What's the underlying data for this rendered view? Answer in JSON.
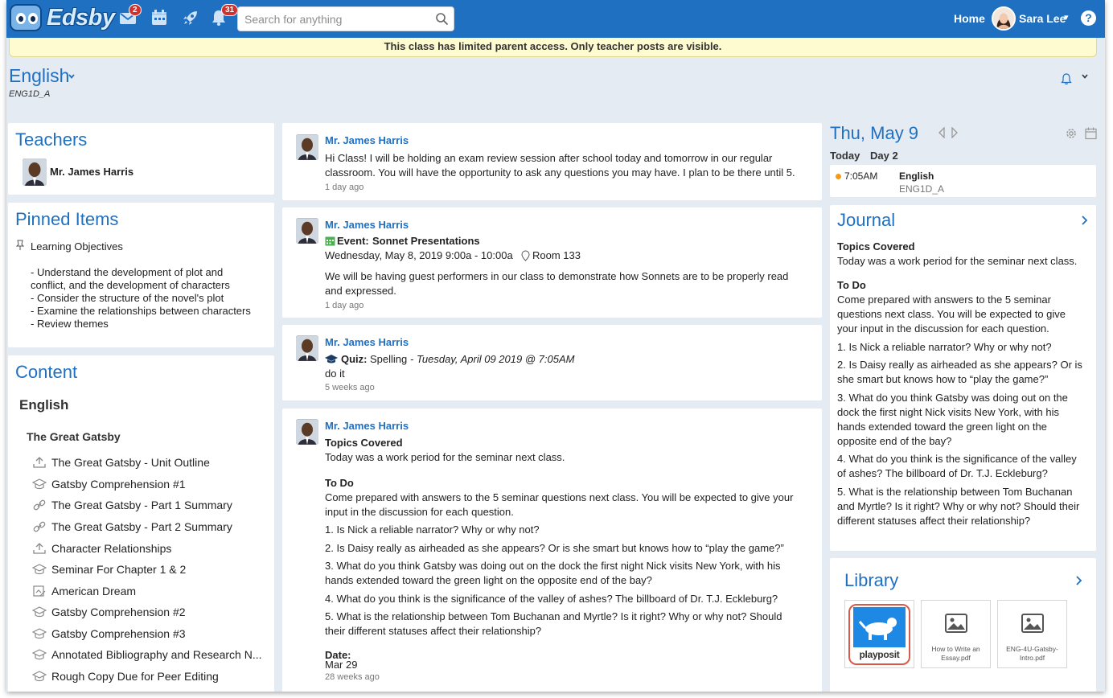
{
  "topbar": {
    "logo_text": "Edsby",
    "messages_badge": "2",
    "notifications_badge": "31",
    "search_placeholder": "Search for anything",
    "home_label": "Home",
    "user_name": "Sara Lee",
    "help_label": "?"
  },
  "banner": "This class has limited parent access. Only teacher posts are visible.",
  "class": {
    "title": "English",
    "code": "ENG1D_A"
  },
  "teachers": {
    "title": "Teachers",
    "name": "Mr. James Harris"
  },
  "pinned": {
    "title": "Pinned Items",
    "item_title": "Learning Objectives",
    "lines": [
      "- Understand the development of plot and",
      "conflict, and the development of characters",
      "- Consider the structure of the novel's plot",
      "- Examine the relationships between characters",
      "- Review themes"
    ]
  },
  "content": {
    "title": "Content",
    "course": "English",
    "unit": "The Great Gatsby",
    "items": [
      {
        "label": "The Great Gatsby - Unit Outline",
        "icon": "upload-icon"
      },
      {
        "label": "Gatsby Comprehension #1",
        "icon": "graduation-cap-icon"
      },
      {
        "label": "The Great Gatsby - Part 1 Summary",
        "icon": "link-icon"
      },
      {
        "label": "The Great Gatsby - Part 2 Summary",
        "icon": "link-icon"
      },
      {
        "label": "Character Relationships",
        "icon": "upload-icon"
      },
      {
        "label": "Seminar For Chapter 1 & 2",
        "icon": "graduation-cap-icon"
      },
      {
        "label": "American Dream",
        "icon": "assignment-icon"
      },
      {
        "label": "Gatsby Comprehension #2",
        "icon": "graduation-cap-icon"
      },
      {
        "label": "Gatsby Comprehension #3",
        "icon": "graduation-cap-icon"
      },
      {
        "label": "Annotated Bibliography and Research N...",
        "icon": "graduation-cap-icon"
      },
      {
        "label": "Rough Copy Due for Peer Editing",
        "icon": "graduation-cap-icon"
      }
    ]
  },
  "feed": {
    "posts": [
      {
        "author": "Mr. James Harris",
        "lines": [
          "Hi Class! I will be holding an exam review session after school today and tomorrow in our regular",
          "classroom. You will have the opportunity to ask any questions you may have. I plan to be there until 5."
        ],
        "ago": "1 day ago"
      },
      {
        "author": "Mr. James Harris",
        "event_label": "Event:",
        "event_title": "Sonnet Presentations",
        "event_time": "Wednesday, May 8, 2019 9:00a - 10:00a",
        "event_room": "Room 133",
        "lines": [
          "We will be having guest performers in our class to demonstrate how Sonnets are to be properly read",
          "and expressed."
        ],
        "ago": "1 day ago"
      },
      {
        "author": "Mr. James Harris",
        "quiz_label": "Quiz:",
        "quiz_title": "Spelling",
        "quiz_due": "- Tuesday, April 09 2019 @ 7:05AM",
        "body": "do it",
        "ago": "5 weeks ago"
      },
      {
        "author": "Mr. James Harris",
        "h1": "Topics Covered",
        "p1": "Today was a work period for the seminar next class.",
        "h2": "To Do",
        "p2a": "Come prepared with answers to the 5 seminar questions next class. You will be expected to give your",
        "p2b": "input in the discussion for each question.",
        "q1": "1. Is Nick a reliable narrator? Why or why not?",
        "q2": "2. Is Daisy really as airheaded as she appears? Or is she smart but knows how to “play the game?”",
        "q3a": "3. What do you think Gatsby was doing out on the dock the first night Nick visits New York, with his",
        "q3b": "hands extended toward the green light on the opposite end of the bay?",
        "q4": "4. What do you think is the significance of the valley of ashes? The billboard of Dr. T.J. Eckleburg?",
        "q5a": "5. What is the relationship between Tom Buchanan and Myrtle? Is it right? Why or why not? Should",
        "q5b": "their different statuses affect their relationship?",
        "date_label": "Date:",
        "date_value": "Mar 29",
        "ago": "28 weeks ago"
      }
    ]
  },
  "calendar": {
    "date": "Thu, May 9",
    "today": "Today",
    "day": "Day 2",
    "event_time": "7:05AM",
    "event_title": "English",
    "event_code": "ENG1D_A",
    "dot_color": "#f39c12"
  },
  "journal": {
    "title": "Journal",
    "h1": "Topics Covered",
    "p1": "Today was a work period for the seminar next class.",
    "h2": "To Do",
    "p2": [
      "Come prepared with answers to the 5 seminar",
      "questions next class. You will be expected to give",
      "your input in the discussion for each question."
    ],
    "q1": "1. Is Nick a reliable narrator? Why or why not?",
    "q2": [
      "2. Is Daisy really as airheaded as she appears? Or is",
      "she smart but knows how to “play the game?”"
    ],
    "q3": [
      "3. What do you think Gatsby was doing out on the",
      "dock the first night Nick visits New York, with his",
      "hands extended toward the green light on the",
      "opposite end of the bay?"
    ],
    "q4": [
      "4. What do you think is the significance of the valley",
      "of ashes? The billboard of Dr. T.J. Eckleburg?"
    ],
    "q5": [
      "5. What is the relationship between Tom Buchanan",
      "and Myrtle? Is it right? Why or why not? Should their",
      "different statuses affect their relationship?"
    ]
  },
  "library": {
    "title": "Library",
    "tiles": [
      {
        "caption": "playposit",
        "icon": "playposit-logo"
      },
      {
        "caption_lines": [
          "How to Write an",
          "Essay.pdf"
        ],
        "icon": "image-icon"
      },
      {
        "caption_lines": [
          "ENG-4U-Gatsby-",
          "Intro.pdf"
        ],
        "icon": "image-icon"
      }
    ]
  },
  "colors": {
    "brand": "#1f70c1",
    "badge": "#d0312d",
    "banner": "#fefbd1"
  }
}
